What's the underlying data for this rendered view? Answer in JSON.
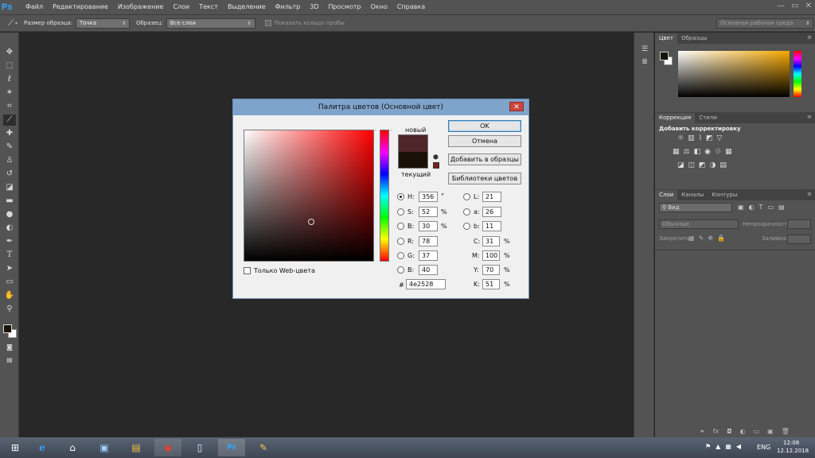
{
  "app": {
    "logo": "Ps",
    "menu": [
      "Файл",
      "Редактирование",
      "Изображение",
      "Слои",
      "Текст",
      "Выделение",
      "Фильтр",
      "3D",
      "Просмотр",
      "Окно",
      "Справка"
    ],
    "window_controls": [
      "—",
      "▭",
      "✕"
    ]
  },
  "options": {
    "sample_size_label": "Размер образца:",
    "sample_size_value": "Точка",
    "sample_label": "Образец:",
    "sample_value": "Все слои",
    "show_ring_label": "Показать кольцо пробы",
    "workspace": "Основная рабочая среда"
  },
  "panels": {
    "color_tabs": [
      "Цвет",
      "Образцы"
    ],
    "adjust_tabs": [
      "Коррекция",
      "Стили"
    ],
    "adjust_add": "Добавить корректировку",
    "layers_tabs": [
      "Слои",
      "Каналы",
      "Контуры"
    ],
    "layers_filter": "Вид",
    "blend_mode": "Обычные",
    "opacity_label": "Непрозрачность:",
    "lock_label": "Закрепить:",
    "fill_label": "Заливка:"
  },
  "dialog": {
    "title": "Палитра цветов (Основной цвет)",
    "close": "✕",
    "new_label": "новый",
    "current_label": "текущий",
    "new_color": "#4e2528",
    "current_color": "#1a1208",
    "ok": "OK",
    "cancel": "Отмена",
    "add_swatch": "Добавить в образцы",
    "libraries": "Библиотеки цветов",
    "web_only": "Только Web-цвета",
    "hsb": {
      "H_label": "H:",
      "H": "356",
      "H_unit": "°",
      "S_label": "S:",
      "S": "52",
      "S_unit": "%",
      "B_label": "B:",
      "B": "30",
      "B_unit": "%"
    },
    "rgb": {
      "R_label": "R:",
      "R": "78",
      "G_label": "G:",
      "G": "37",
      "B_label": "B:",
      "B": "40"
    },
    "lab": {
      "L_label": "L:",
      "L": "21",
      "a_label": "a:",
      "a": "26",
      "b_label": "b:",
      "b": "11"
    },
    "cmyk": {
      "C_label": "C:",
      "C": "31",
      "C_unit": "%",
      "M_label": "M:",
      "M": "100",
      "M_unit": "%",
      "Y_label": "Y:",
      "Y": "70",
      "Y_unit": "%",
      "K_label": "K:",
      "K": "51",
      "K_unit": "%"
    },
    "hex_label": "#",
    "hex": "4e2528",
    "field_hue_color": "#ff0000"
  },
  "taskbar": {
    "lang": "ENG",
    "time": "12:08",
    "date": "12.12.2018"
  }
}
